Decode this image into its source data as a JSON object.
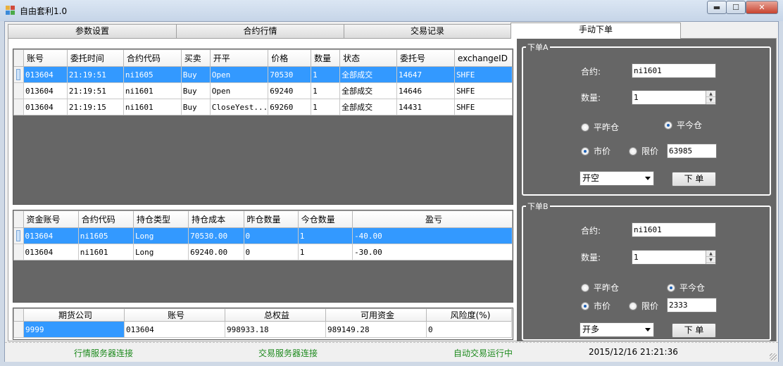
{
  "window": {
    "title": "自由套利1.0",
    "min_glyph": "▬",
    "max_glyph": "☐",
    "close_glyph": "✕"
  },
  "tabs": [
    {
      "label": "参数设置"
    },
    {
      "label": "合约行情"
    },
    {
      "label": "交易记录"
    },
    {
      "label": "手动下单"
    }
  ],
  "orders": {
    "headers": [
      "账号",
      "委托时间",
      "合约代码",
      "买卖",
      "开平",
      "价格",
      "数量",
      "状态",
      "委托号",
      "exchangeID"
    ],
    "rows": [
      [
        "013604",
        "21:19:51",
        "ni1605",
        "Buy",
        "Open",
        "70530",
        "1",
        "全部成交",
        "14647",
        "SHFE"
      ],
      [
        "013604",
        "21:19:51",
        "ni1601",
        "Buy",
        "Open",
        "69240",
        "1",
        "全部成交",
        "14646",
        "SHFE"
      ],
      [
        "013604",
        "21:19:15",
        "ni1601",
        "Buy",
        "CloseYest...",
        "69260",
        "1",
        "全部成交",
        "14431",
        "SHFE"
      ]
    ]
  },
  "positions": {
    "headers": [
      "资金账号",
      "合约代码",
      "持仓类型",
      "持仓成本",
      "昨仓数量",
      "今仓数量",
      "盈亏"
    ],
    "rows": [
      [
        "013604",
        "ni1605",
        "Long",
        "70530.00",
        "0",
        "1",
        "-40.00"
      ],
      [
        "013604",
        "ni1601",
        "Long",
        "69240.00",
        "0",
        "1",
        "-30.00"
      ]
    ]
  },
  "account": {
    "headers": [
      "期货公司",
      "账号",
      "总权益",
      "可用资金",
      "风险度(%)"
    ],
    "rows": [
      [
        "9999",
        "013604",
        "998933.18",
        "989149.28",
        "0"
      ]
    ]
  },
  "orderA": {
    "title": "下单A",
    "contract_label": "合约:",
    "contract_value": "ni1601",
    "qty_label": "数量:",
    "qty_value": "1",
    "close_yesterday": "平昨仓",
    "close_today": "平今仓",
    "market": "市价",
    "limit": "限价",
    "limit_value": "63985",
    "action": "开空",
    "submit": "下 单"
  },
  "orderB": {
    "title": "下单B",
    "contract_label": "合约:",
    "contract_value": "ni1601",
    "qty_label": "数量:",
    "qty_value": "1",
    "close_yesterday": "平昨仓",
    "close_today": "平今仓",
    "market": "市价",
    "limit": "限价",
    "limit_value": "2333",
    "action": "开多",
    "submit": "下 单"
  },
  "status": {
    "quote": "行情服务器连接",
    "trade": "交易服务器连接",
    "auto": "自动交易运行中",
    "datetime": "2015/12/16 21:21:36"
  },
  "colors": {
    "status_green": "#1d8a1d",
    "selection": "#3399ff",
    "panel": "#666666"
  }
}
